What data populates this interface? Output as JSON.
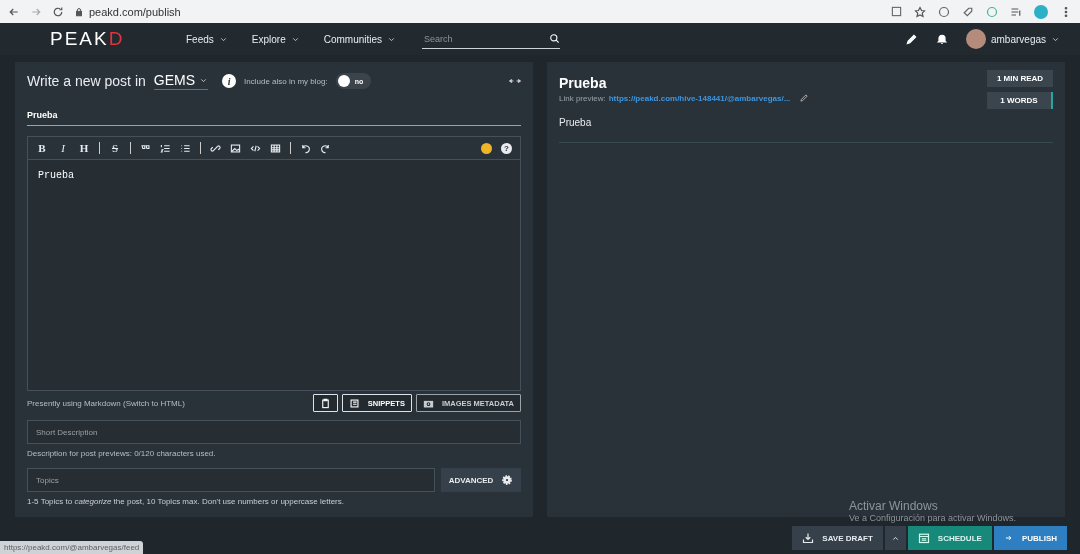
{
  "browser": {
    "url": "peakd.com/publish"
  },
  "navbar": {
    "logo_main": "PEAK",
    "logo_accent": "D",
    "menu": [
      {
        "label": "Feeds"
      },
      {
        "label": "Explore"
      },
      {
        "label": "Communities"
      }
    ],
    "search": {
      "placeholder": "Search"
    },
    "username": "ambarvegas"
  },
  "editor": {
    "heading": "Write a new post in",
    "community": "GEMS",
    "info_glyph": "i",
    "help_glyph": "?",
    "include_label": "Include also in my blog:",
    "include_toggle": {
      "on": false,
      "label": "no"
    },
    "title_value": "Prueba",
    "toolbar_letters": [
      "B",
      "I",
      "H",
      "S"
    ],
    "body": "Prueba",
    "mode_text": "Presently using Markdown (Switch to HTML)",
    "snippets_button": "SNIPPETS",
    "images_button": "IMAGES METADATA",
    "description": {
      "placeholder": "Short Description"
    },
    "description_help": "Description for post previews: 0/120 characters used.",
    "topics": {
      "placeholder": "Topics"
    },
    "advanced_button": "ADVANCED",
    "topics_help": "1-5 Topics to *categorize* the post, 10 Topics max. Don't use numbers or uppercase letters."
  },
  "preview": {
    "title": "Prueba",
    "link_label": "Link preview:",
    "link": "https://peakd.com/hive-148441/@ambarvegas/...",
    "badges": [
      "1 MIN READ",
      "1 WORDS"
    ],
    "body": "Prueba"
  },
  "footer": {
    "save_draft": "SAVE DRAFT",
    "schedule": "SCHEDULE",
    "publish": "PUBLISH"
  },
  "status_url": "https://peakd.com/@ambarvegas/feed",
  "os_notice": {
    "title": "Activar Windows",
    "text": "Ve a Configuración para activar Windows."
  }
}
